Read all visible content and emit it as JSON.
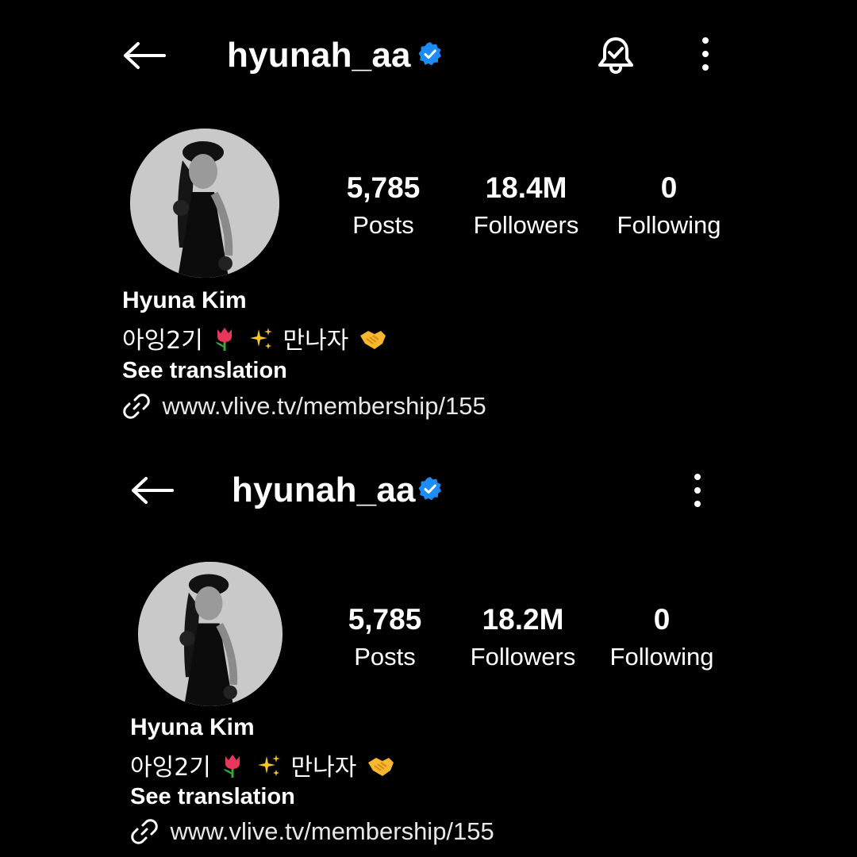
{
  "top": {
    "header": {
      "username": "hyunah_aa"
    },
    "stats": [
      {
        "value": "5,785",
        "label": "Posts"
      },
      {
        "value": "18.4M",
        "label": "Followers"
      },
      {
        "value": "0",
        "label": "Following"
      }
    ],
    "bio": {
      "name": "Hyuna Kim",
      "text_a": "아잉2기",
      "text_b": "만나자",
      "see_translation": "See translation",
      "link": "www.vlive.tv/membership/155"
    }
  },
  "bottom": {
    "header": {
      "username": "hyunah_aa"
    },
    "stats": [
      {
        "value": "5,785",
        "label": "Posts"
      },
      {
        "value": "18.2M",
        "label": "Followers"
      },
      {
        "value": "0",
        "label": "Following"
      }
    ],
    "bio": {
      "name": "Hyuna Kim",
      "text_a": "아잉2기",
      "text_b": "만나자",
      "see_translation": "See translation",
      "link": "www.vlive.tv/membership/155"
    }
  },
  "colors": {
    "background": "#000000",
    "verified": "#1d8cf8",
    "text": "#ffffff"
  },
  "icons": [
    "back-arrow-icon",
    "verified-badge-icon",
    "notification-bell-icon",
    "more-options-icon",
    "link-icon",
    "tulip-emoji-icon",
    "sparkles-emoji-icon",
    "handshake-emoji-icon"
  ]
}
